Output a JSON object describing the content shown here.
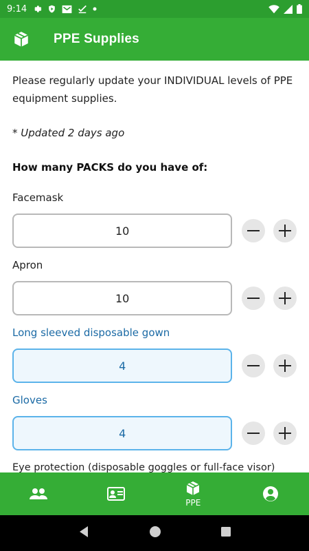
{
  "status_bar": {
    "time": "9:14",
    "icons": [
      "settings-icon",
      "shield-icon",
      "mail-icon",
      "check-download-icon",
      "dot-icon",
      "wifi-icon",
      "signal-icon",
      "battery-icon"
    ]
  },
  "app_bar": {
    "title": "PPE Supplies",
    "icon": "box-icon"
  },
  "intro_text": "Please regularly update your INDIVIDUAL levels of PPE equipment supplies.",
  "updated_text": "* Updated 2 days ago",
  "question": "How many PACKS do you have of:",
  "items": [
    {
      "label": "Facemask",
      "value": "10"
    },
    {
      "label": "Apron",
      "value": "10"
    },
    {
      "label": "Long sleeved disposable gown",
      "value": "4"
    },
    {
      "label": "Gloves",
      "value": "4"
    },
    {
      "label": "Eye protection (disposable goggles or full-face visor)",
      "value": ""
    }
  ],
  "bottom_nav": {
    "items": [
      {
        "icon": "people-icon",
        "label": ""
      },
      {
        "icon": "id-card-icon",
        "label": ""
      },
      {
        "icon": "box-icon",
        "label": "PPE"
      },
      {
        "icon": "account-icon",
        "label": ""
      }
    ]
  },
  "colors": {
    "primary": "#35ad36",
    "status_bar": "#2c9e2f",
    "focused_border": "#5bb3ea",
    "focused_fill": "#eef7fd",
    "focused_text": "#1b6aa5"
  }
}
